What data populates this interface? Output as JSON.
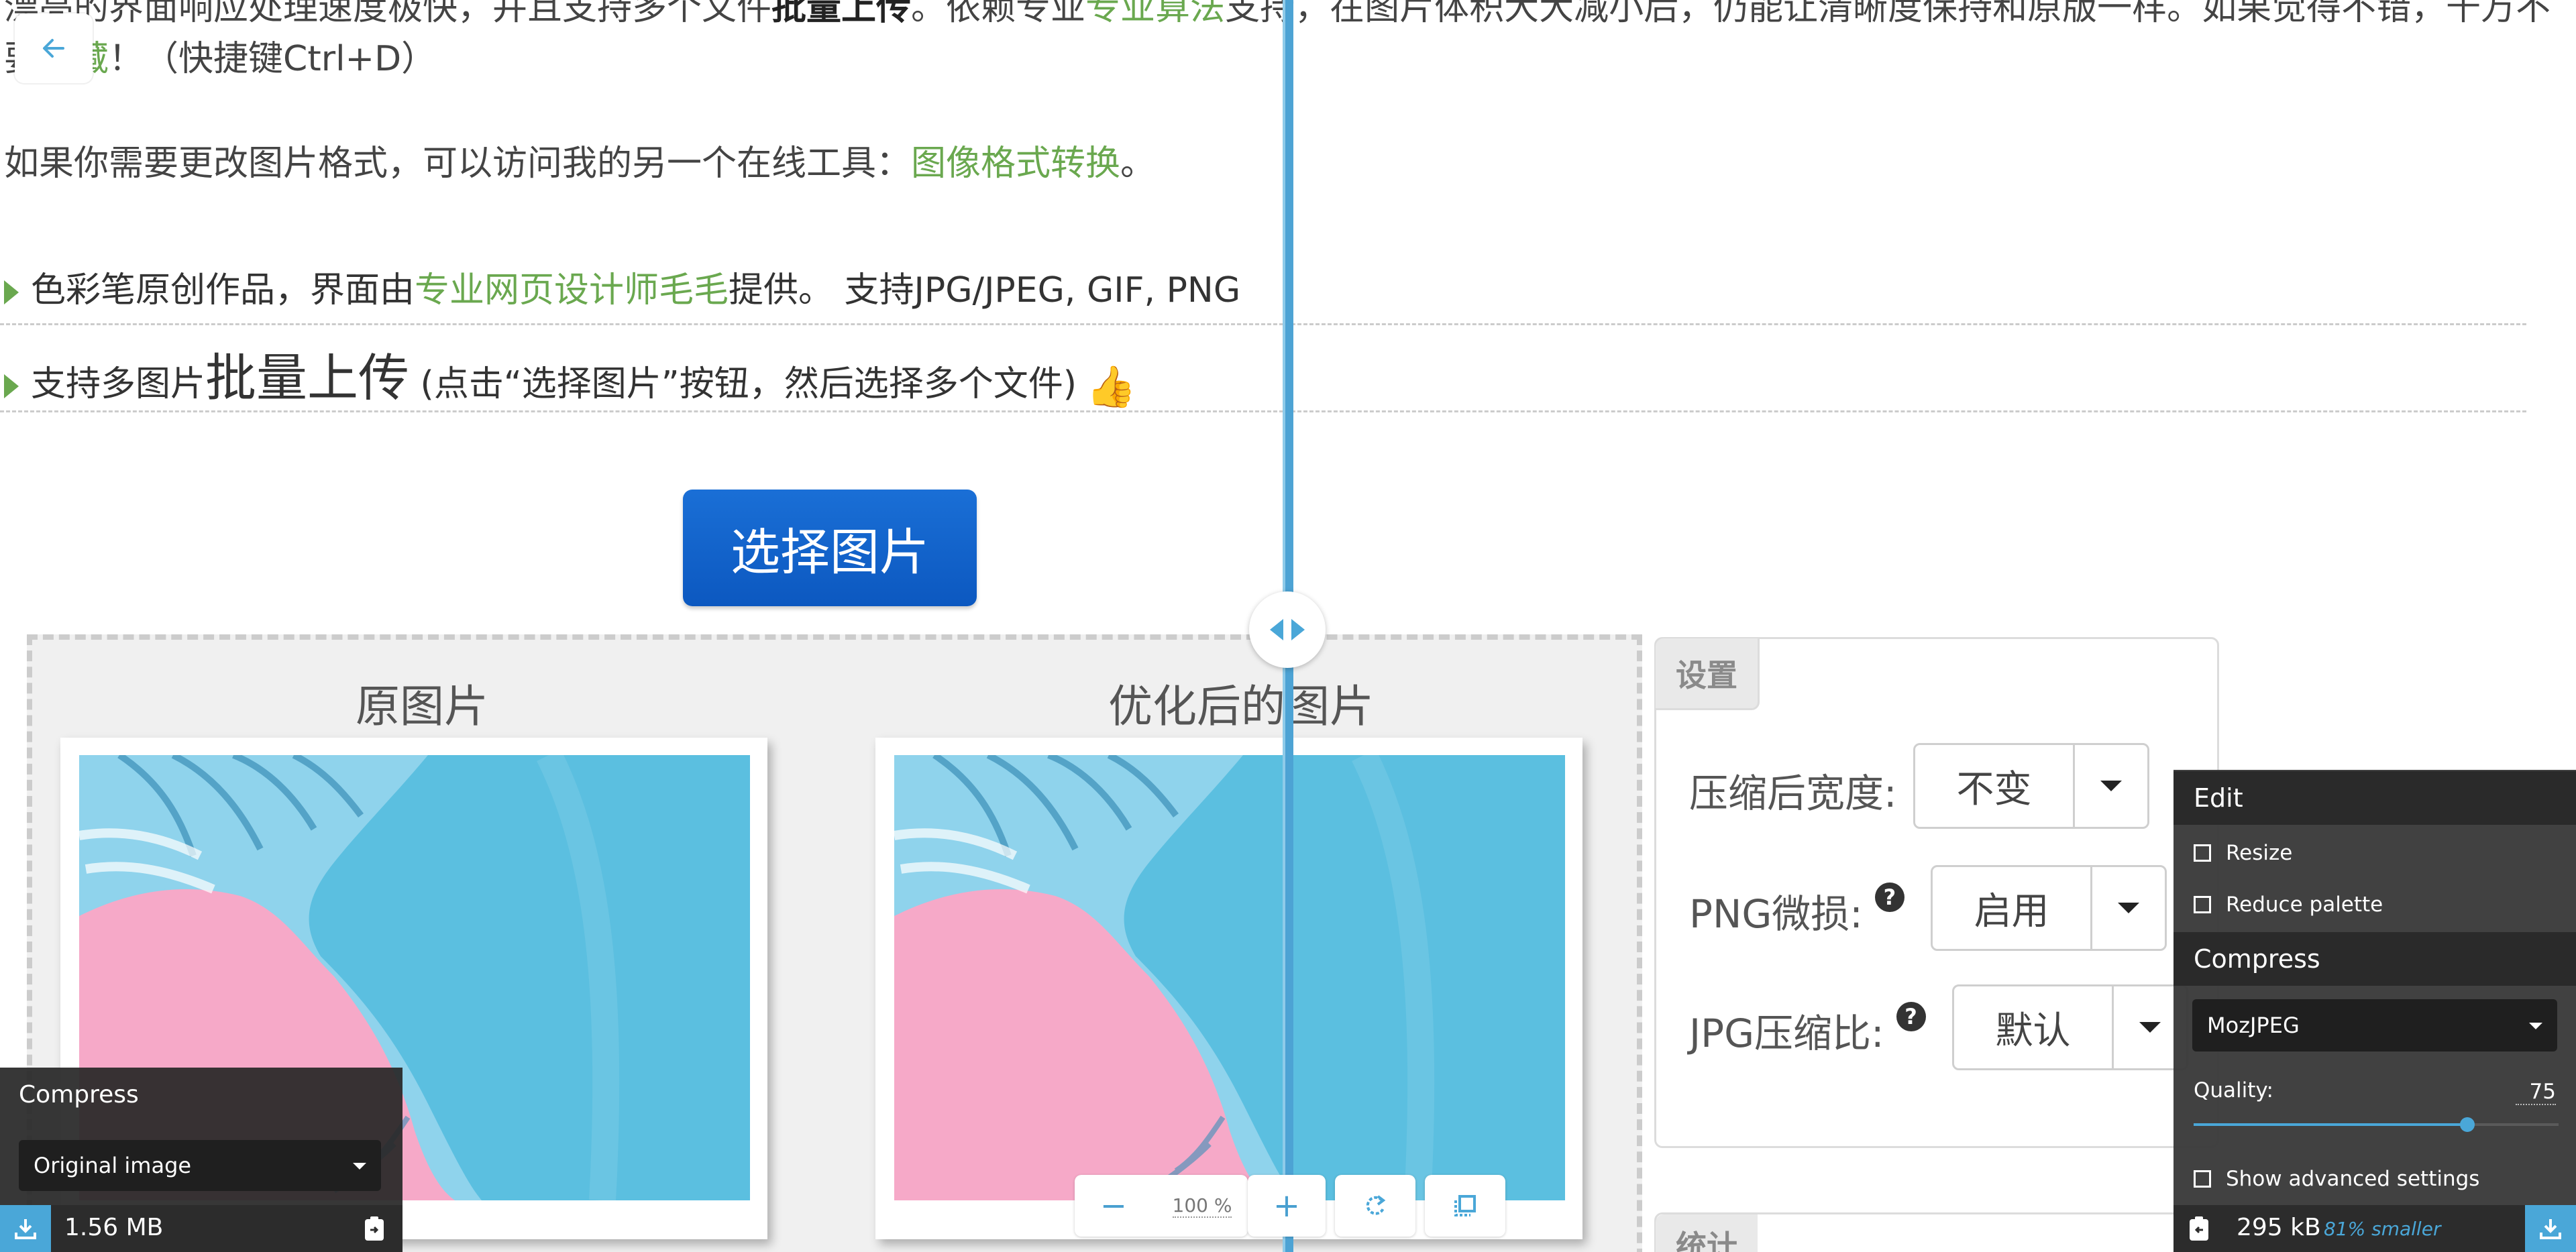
{
  "article": {
    "line1_part1": "漂亮的界面响应处理速度极快，并且支持多个文件",
    "line1_bold": "批量上传",
    "line1_part2": "。依赖专业",
    "line1_link": "专业算法",
    "line1_part3": "支持，在图片体积大大减小后，仍能让清晰度保持和原版一样。如果觉得不错，千万不",
    "line2_part1": "要",
    "line2_link": "收藏",
    "line2_part2": "！（快捷键Ctrl+D）",
    "line3_text": "如果你需要更改图片格式，可以访问我的另一个在线工具：",
    "line3_link": "图像格式转换",
    "line3_end": "。",
    "feature1_part1": "色彩笔原创作品，界面由",
    "feature1_link": "专业网页设计师毛毛",
    "feature1_part2": "提供。 支持JPG/JPEG, GIF, PNG",
    "feature2_part1": "支持多图片",
    "feature2_big": "批量上传",
    "feature2_part2": "(点击“选择图片”按钮，然后选择多个文件)"
  },
  "select_button_label": "选择图片",
  "compare": {
    "original_title": "原图片",
    "optimized_title": "优化后的图片"
  },
  "settings": {
    "tab_label": "设置",
    "width_label": "压缩后宽度:",
    "width_value": "不变",
    "png_label": "PNG微损:",
    "png_value": "启用",
    "jpg_label": "JPG压缩比:",
    "jpg_value": "默认",
    "help_glyph": "?",
    "stats_tab_label": "统计"
  },
  "zoom": {
    "minus": "−",
    "value": "100 %",
    "plus": "+"
  },
  "left_panel": {
    "title": "Compress",
    "select_value": "Original image",
    "size": "1.56 MB"
  },
  "right_panel": {
    "edit_title": "Edit",
    "resize_label": "Resize",
    "reduce_palette_label": "Reduce palette",
    "compress_title": "Compress",
    "encoder_value": "MozJPEG",
    "quality_label": "Quality:",
    "quality_value": "75",
    "quality_fraction": 0.75,
    "advanced_label": "Show advanced settings",
    "size": "295 kB",
    "smaller": "81% smaller"
  },
  "colors": {
    "accent_green": "#6aa84f",
    "button_blue": "#1a6fd6",
    "squoosh_blue": "#4aa7d8",
    "art_pink": "#f6a9c8",
    "art_blue": "#5bbfe0"
  }
}
